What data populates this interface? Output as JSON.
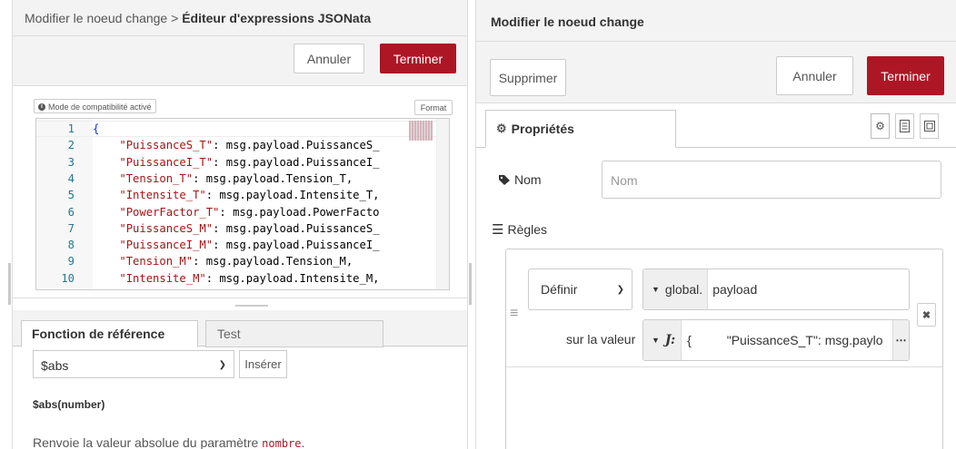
{
  "expr_editor": {
    "breadcrumb_parent": "Modifier le noeud change",
    "breadcrumb_sep": " > ",
    "breadcrumb_current": "Éditeur d'expressions JSONata",
    "cancel_label": "Annuler",
    "done_label": "Terminer",
    "compat_label": "Mode de compatibilité activé",
    "format_label": "Format",
    "code_lines": [
      {
        "num": "1",
        "code": "{"
      },
      {
        "num": "2",
        "key": "\"PuissanceS_T\"",
        "rest": ": msg.payload.PuissanceS_"
      },
      {
        "num": "3",
        "key": "\"PuissanceI_T\"",
        "rest": ": msg.payload.PuissanceI_"
      },
      {
        "num": "4",
        "key": "\"Tension_T\"",
        "rest": ": msg.payload.Tension_T,"
      },
      {
        "num": "5",
        "key": "\"Intensite_T\"",
        "rest": ": msg.payload.Intensite_T,"
      },
      {
        "num": "6",
        "key": "\"PowerFactor_T\"",
        "rest": ": msg.payload.PowerFacto"
      },
      {
        "num": "7",
        "key": "\"PuissanceS_M\"",
        "rest": ": msg.payload.PuissanceS_"
      },
      {
        "num": "8",
        "key": "\"PuissanceI_M\"",
        "rest": ": msg.payload.PuissanceI_"
      },
      {
        "num": "9",
        "key": "\"Tension_M\"",
        "rest": ": msg.payload.Tension_M,"
      },
      {
        "num": "10",
        "key": "\"Intensite_M\"",
        "rest": ": msg.payload.Intensite_M,"
      }
    ],
    "tabs": [
      {
        "label": "Fonction de référence",
        "active": true
      },
      {
        "label": "Test",
        "active": false
      }
    ],
    "function_select": "$abs",
    "insert_label": "Insérer",
    "signature": "$abs(number)",
    "description_prefix": "Renvoie la valeur absolue du paramètre ",
    "description_param": "nombre",
    "description_suffix": "."
  },
  "change_node": {
    "title": "Modifier le noeud change",
    "delete_label": "Supprimer",
    "cancel_label": "Annuler",
    "done_label": "Terminer",
    "tab_properties": "Propriétés",
    "name_label": "Nom",
    "name_placeholder": "Nom",
    "rules_label": "Règles",
    "rule": {
      "action": "Définir",
      "target_type": "global.",
      "target_value": "payload",
      "to_label": "sur la valeur",
      "value_type_symbol": "J:",
      "value_text": "{          \"PuissanceS_T\": msg.paylo"
    }
  },
  "colors": {
    "primary": "#ad1625",
    "header_bg": "#f3f3f3",
    "string": "#a31515",
    "line_number": "#237893"
  }
}
